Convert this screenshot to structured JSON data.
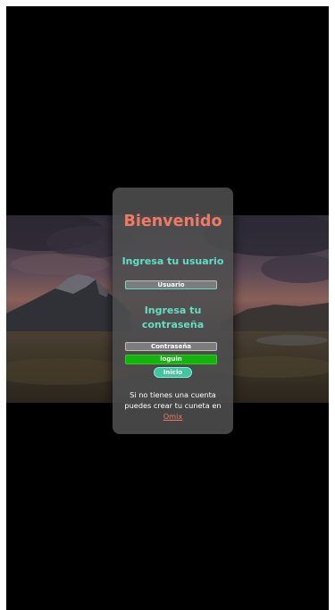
{
  "login": {
    "title": "Bienvenido",
    "username_prompt": "Ingresa tu usuario",
    "username_placeholder": "Usuario",
    "password_prompt": "Ingresa tu contraseña",
    "password_placeholder": "Contraseña",
    "login_button": "loguin",
    "home_button": "Inicio",
    "signup_text": "Si no tienes una cuenta puedes crear tu cuneta en",
    "signup_link": "Omix"
  },
  "colors": {
    "title": "#f07a62",
    "accent": "#5fe0c4",
    "login_button": "#16b310",
    "home_button": "#43c4a0",
    "link": "#f07a62"
  }
}
